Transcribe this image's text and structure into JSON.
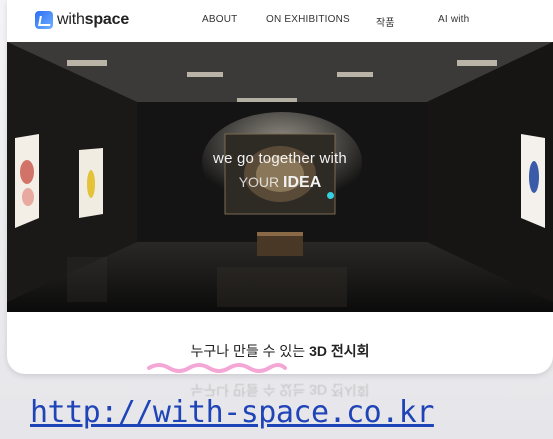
{
  "brand": {
    "prefix": "with",
    "suffix": "space"
  },
  "nav": {
    "items": [
      "ABOUT",
      "ON EXHIBITIONS",
      "작품",
      "AI with"
    ]
  },
  "hero": {
    "line1": "we go together with",
    "line2_pre": "YOUR ",
    "line2_bold": "IDEA"
  },
  "tagline": {
    "pre": "누구나 만들 수 있는 ",
    "bold": "3D 전시회",
    "reflection": "누구나 만들 수 있는 3D 전시회"
  },
  "link": {
    "url": "http://with-space.co.kr"
  },
  "colors": {
    "link": "#1f44b8",
    "accent_wave": "#f4a6d4",
    "logo": "#2a6df5",
    "cursor": "#36d1e0"
  }
}
